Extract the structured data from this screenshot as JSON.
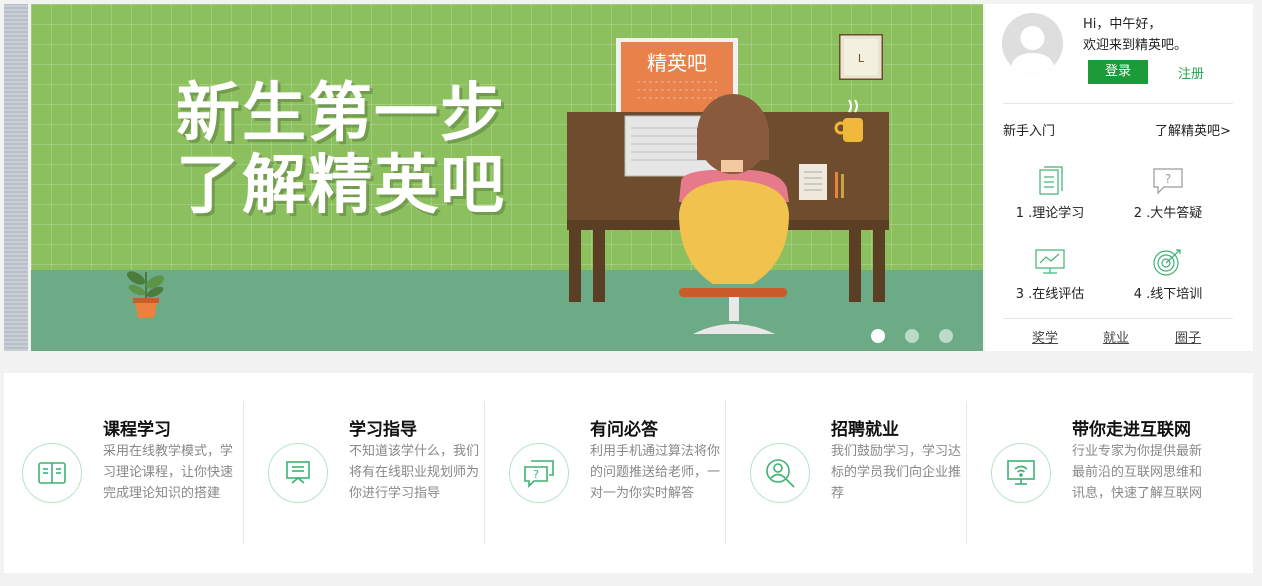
{
  "banner": {
    "slogan_line1": "新生第一步",
    "slogan_line2": "了解精英吧",
    "monitor_label": "精英吧",
    "clock_label": "L",
    "slides": 3,
    "active_slide": 1
  },
  "user": {
    "greeting": "Hi，中午好，",
    "welcome": "欢迎来到精英吧。",
    "login_label": "登录",
    "register_label": "注册"
  },
  "guide": {
    "title": "新手入门",
    "more_label": "了解精英吧>",
    "steps": [
      {
        "label": "1 .理论学习",
        "icon": "document-icon"
      },
      {
        "label": "2 .大牛答疑",
        "icon": "question-chat-icon"
      },
      {
        "label": "3 .在线评估",
        "icon": "monitor-chart-icon"
      },
      {
        "label": "4 .线下培训",
        "icon": "target-icon"
      }
    ],
    "links": [
      "奖学",
      "就业",
      "圈子"
    ]
  },
  "features": [
    {
      "title": "课程学习",
      "desc": "采用在线教学模式，学习理论课程，让你快速完成理论知识的搭建",
      "icon": "book-icon"
    },
    {
      "title": "学习指导",
      "desc": "不知道该学什么，我们将有在线职业规划师为你进行学习指导",
      "icon": "board-icon"
    },
    {
      "title": "有问必答",
      "desc": "利用手机通过算法将你的问题推送给老师，一对一为你实时解答",
      "icon": "chat-question-icon"
    },
    {
      "title": "招聘就业",
      "desc": "我们鼓励学习，学习达标的学员我们向企业推荐",
      "icon": "person-search-icon"
    },
    {
      "title": "带你走进互联网",
      "desc": "行业专家为你提供最新最前沿的互联网思维和讯息，快速了解互联网",
      "icon": "wifi-screen-icon"
    }
  ],
  "colors": {
    "accent": "#1b9c39",
    "link_green": "#2aa550",
    "banner_green": "#8cc05f",
    "floor_green": "#6daa86",
    "icon_green": "#3cb371"
  }
}
